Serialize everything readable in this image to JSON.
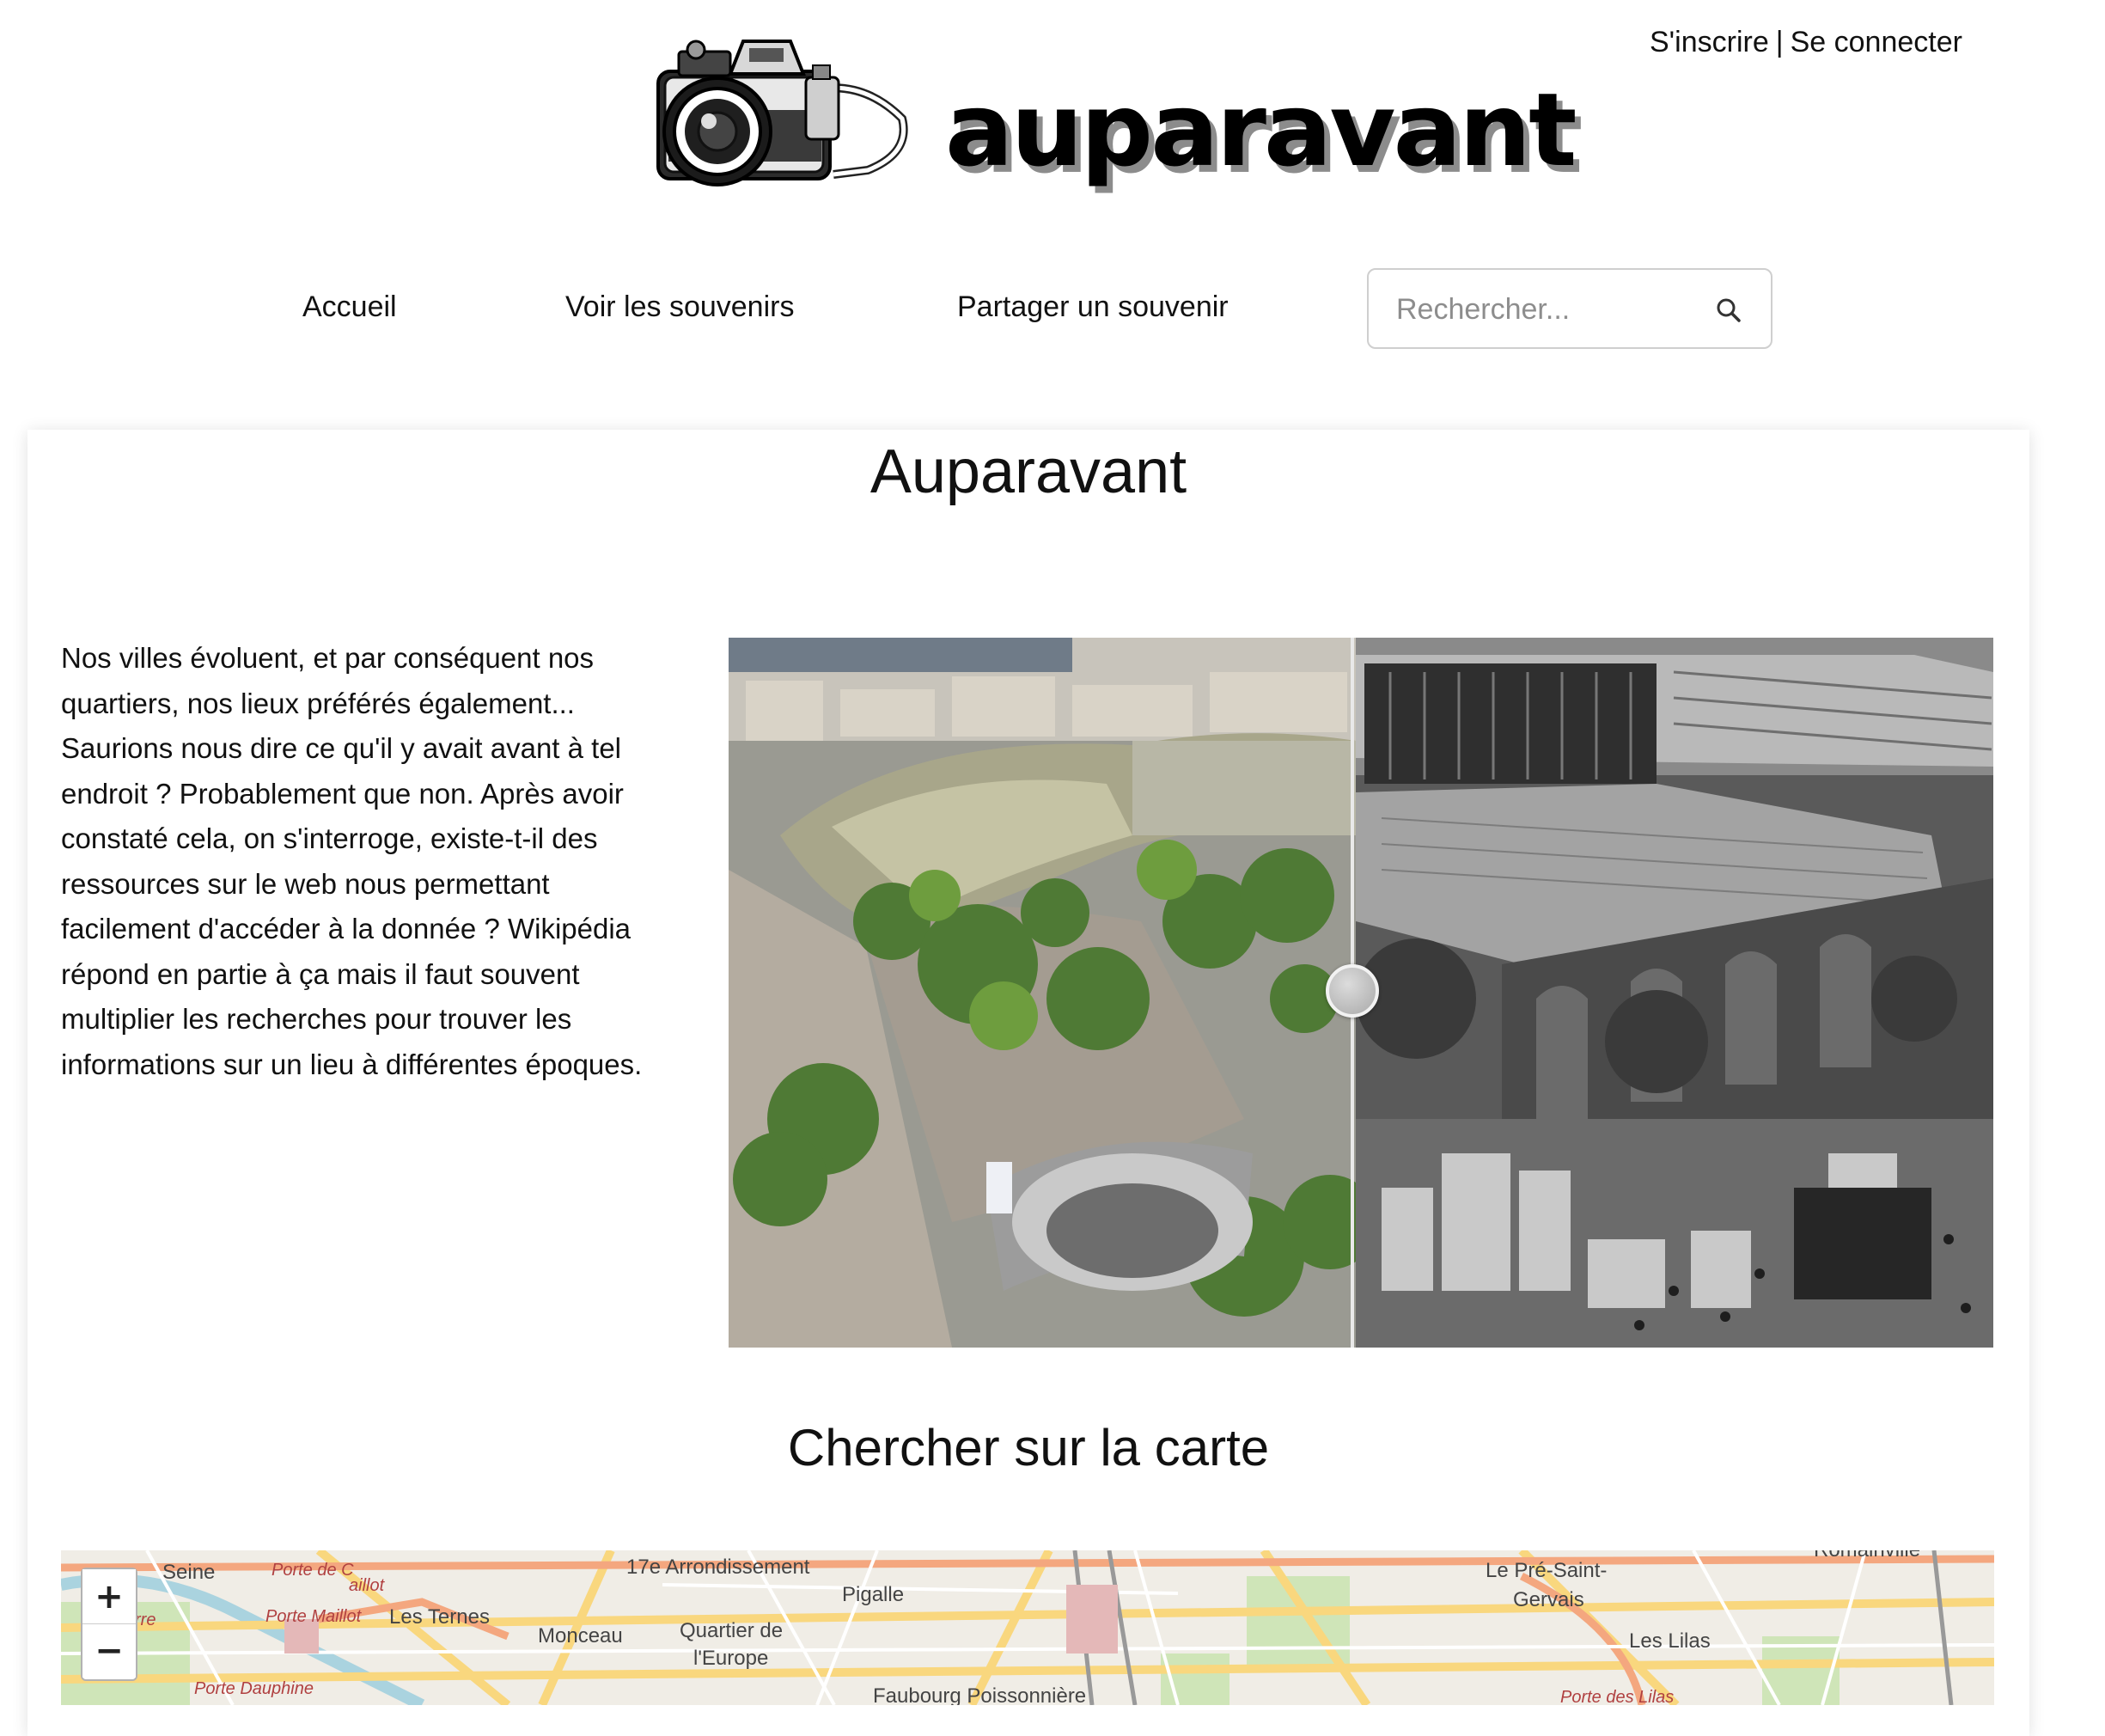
{
  "header": {
    "brand": "auparavant",
    "auth": {
      "register": "S'inscrire",
      "separator": "|",
      "login": "Se connecter"
    }
  },
  "nav": {
    "items": [
      "Accueil",
      "Voir les souvenirs",
      "Partager un souvenir"
    ],
    "search_placeholder": "Rechercher..."
  },
  "main": {
    "title": "Auparavant",
    "intro": "Nos villes évoluent, et par conséquent nos quartiers, nos lieux préférés également... Saurions nous dire ce qu'il y avait avant à tel endroit ? Probablement que non. Après avoir constaté cela, on s'interroge, existe-t-il des ressources sur le web nous permettant facilement d'accéder à la donnée ? Wikipédia répond en partie à ça mais il faut souvent multiplier les recherches pour trouver les informations sur un lieu à différentes époques."
  },
  "map": {
    "title": "Chercher sur la carte",
    "zoom_in": "+",
    "zoom_out": "−",
    "labels": [
      "Seine",
      "Porte de C",
      "aillot",
      "Porte Maillot",
      "rre",
      "Les Ternes",
      "Porte Dauphine",
      "17e Arrondissement",
      "Monceau",
      "Quartier de",
      "l'Europe",
      "Pigalle",
      "Faubourg Poissonnière",
      "Le Pré-Saint-",
      "Gervais",
      "Les Lilas",
      "Porte des Lilas",
      "Romainville"
    ]
  }
}
